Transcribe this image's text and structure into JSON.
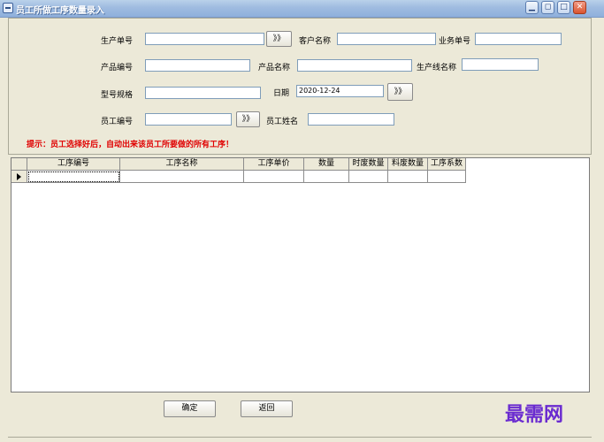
{
  "window": {
    "title": "员工所做工序数量录入",
    "controls": {
      "minimize": "▁",
      "restore": "◻",
      "maximize": "□",
      "close": "✕"
    }
  },
  "form": {
    "order_no": {
      "label": "生产单号",
      "value": ""
    },
    "order_pick": "》》",
    "customer_name": {
      "label": "客户名称",
      "value": ""
    },
    "business_no": {
      "label": "业务单号",
      "value": ""
    },
    "product_no": {
      "label": "产品编号",
      "value": ""
    },
    "product_name": {
      "label": "产品名称",
      "value": ""
    },
    "line_name": {
      "label": "生产线名称",
      "value": ""
    },
    "model_spec": {
      "label": "型号规格",
      "value": ""
    },
    "date": {
      "label": "日期",
      "value": "2020-12-24"
    },
    "date_pick": "》》",
    "employee_no": {
      "label": "员工编号",
      "value": ""
    },
    "employee_pick": "》》",
    "employee_name": {
      "label": "员工姓名",
      "value": ""
    },
    "hint": "提示：员工选择好后，自动出来该员工所要做的所有工序！"
  },
  "grid": {
    "columns": [
      "工序编号",
      "工序名称",
      "工序单价",
      "数量",
      "时废数量",
      "料废数量",
      "工序系数"
    ],
    "rows": [
      [
        "",
        "",
        "",
        "",
        "",
        "",
        ""
      ]
    ]
  },
  "buttons": {
    "ok": "确定",
    "back": "返回"
  },
  "watermark": "最需网",
  "colors": {
    "hint": "#e00000",
    "watermark": "#6a2bd0",
    "titlebar": "#9fbbe0"
  }
}
